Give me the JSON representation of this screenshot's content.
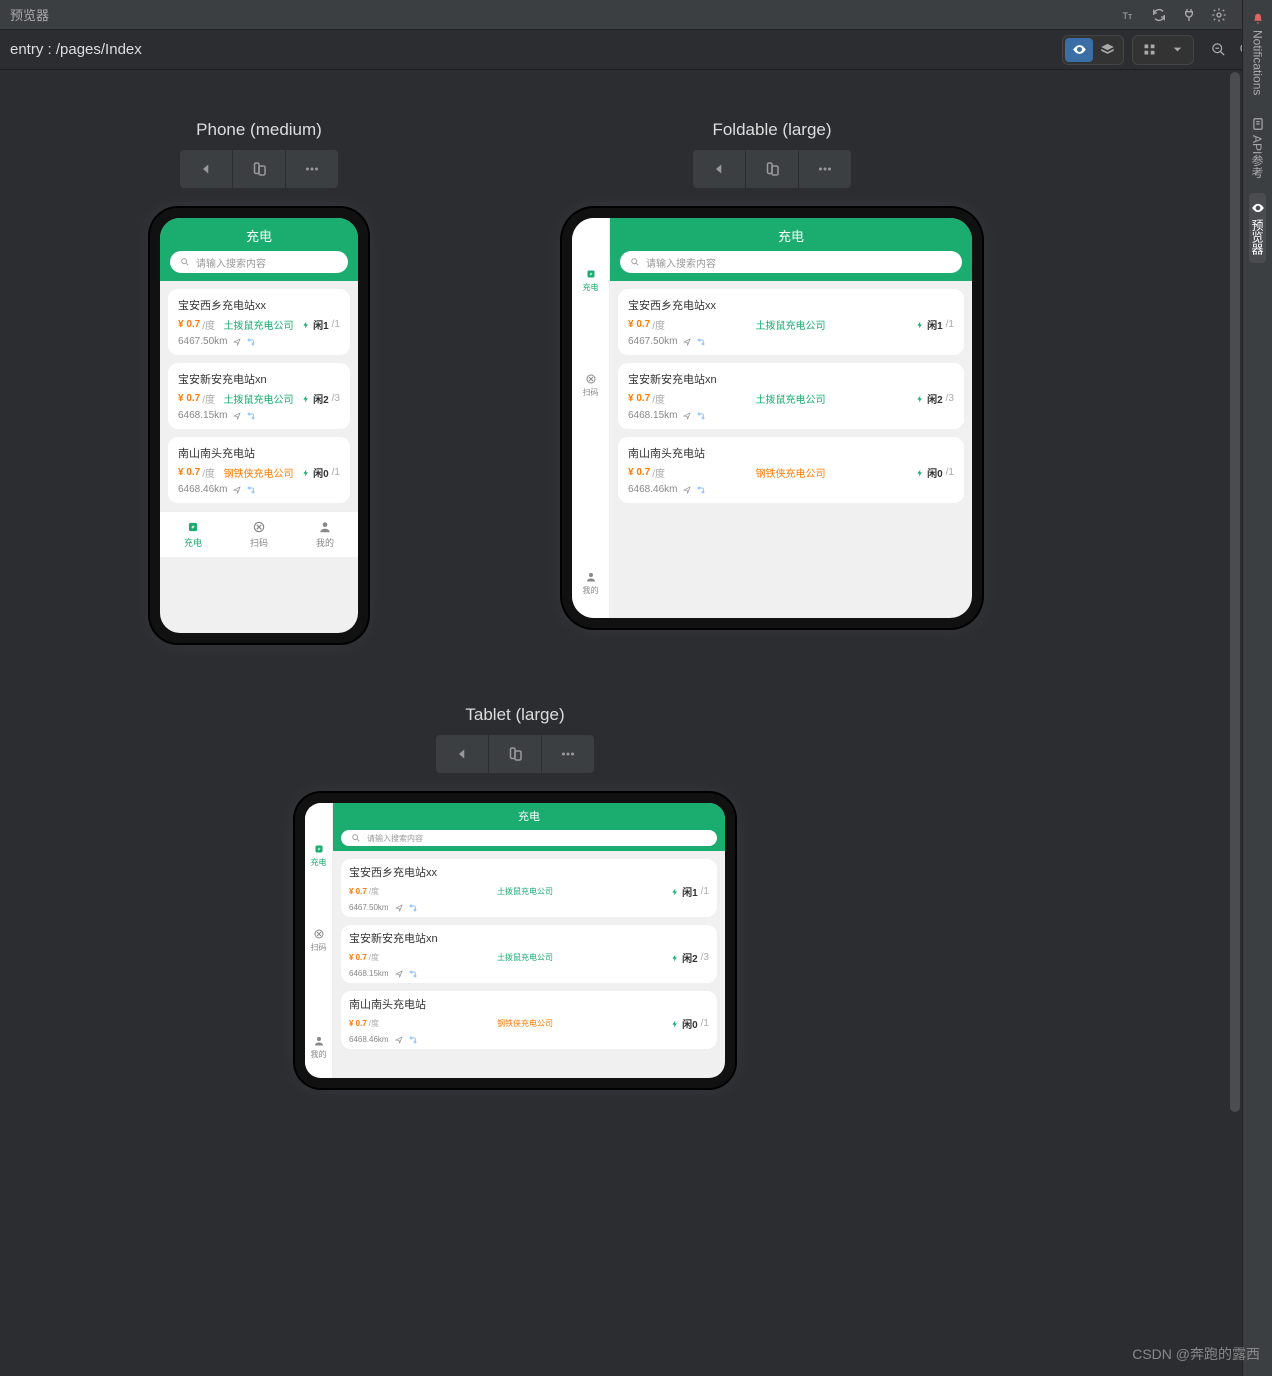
{
  "window": {
    "title": "预览器"
  },
  "breadcrumb": "entry : /pages/Index",
  "sidebar_tabs": [
    {
      "label": "Notifications",
      "active": false
    },
    {
      "label": "API参考",
      "active": false
    },
    {
      "label": "预览器",
      "active": true
    }
  ],
  "devices": [
    {
      "title": "Phone (medium)"
    },
    {
      "title": "Foldable (large)"
    },
    {
      "title": "Tablet (large)"
    }
  ],
  "app": {
    "header_title": "充电",
    "search_placeholder": "请输入搜索内容",
    "price_prefix": "¥",
    "price_unit": "/度",
    "status_prefix": "闲",
    "tabs": [
      {
        "label": "充电"
      },
      {
        "label": "扫码"
      },
      {
        "label": "我的"
      }
    ],
    "stations": [
      {
        "name": "宝安西乡充电站xx",
        "price": "0.7",
        "company": "土拨鼠充电公司",
        "free": "1",
        "total": "1",
        "distance": "6467.50km"
      },
      {
        "name": "宝安新安充电站xn",
        "price": "0.7",
        "company": "土拨鼠充电公司",
        "free": "2",
        "total": "3",
        "distance": "6468.15km"
      },
      {
        "name": "南山南头充电站",
        "price": "0.7",
        "company": "钢铁侠充电公司",
        "free": "0",
        "total": "1",
        "distance": "6468.46km",
        "companyOrange": true
      }
    ]
  },
  "watermark": "CSDN @奔跑的露西"
}
